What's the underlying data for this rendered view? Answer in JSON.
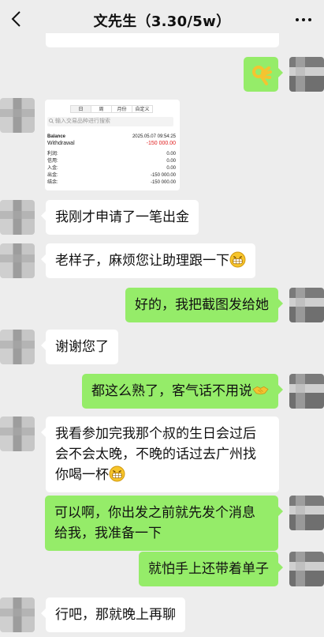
{
  "header": {
    "title": "文先生（3.30/5w）"
  },
  "screenshot": {
    "tabs": [
      "日",
      "周",
      "月份",
      "自定义"
    ],
    "search_placeholder": "输入交易品种进行搜索",
    "balance_label": "Balance",
    "balance_date": "2025.05.07 09:54:25",
    "withdrawal_label": "Withdrawal",
    "withdrawal_value": "-150 000.00",
    "rows": [
      {
        "label": "利润:",
        "value": "0.00"
      },
      {
        "label": "信用:",
        "value": "0.00"
      },
      {
        "label": "入金:",
        "value": "0.00"
      },
      {
        "label": "出金:",
        "value": "-150 000.00"
      },
      {
        "label": "结余:",
        "value": "-150 000.00"
      }
    ]
  },
  "messages": [
    {
      "side": "in",
      "text": "我刚才申请了一笔出金"
    },
    {
      "side": "in",
      "text": "老样子，麻烦您让助理跟一下"
    },
    {
      "side": "out",
      "text": "好的，我把截图发给她"
    },
    {
      "side": "in",
      "text": "谢谢您了"
    },
    {
      "side": "out",
      "text": "都这么熟了，客气话不用说"
    },
    {
      "side": "in",
      "line1": "我看参加完我那个叔的生日会过后",
      "line2": "会不会太晚，不晚的话过去广州找",
      "line3": "你喝一杯"
    },
    {
      "side": "out",
      "line1": "可以啊，你出发之前就先发个消息",
      "line2": "给我，我准备一下"
    },
    {
      "side": "out",
      "text": "就怕手上还带着单子"
    },
    {
      "side": "in",
      "text": "行吧，那就晚上再聊"
    }
  ],
  "icons": {
    "ok_hand": "ok-hand-emoji",
    "grin": "grin-emoji",
    "handshake": "handshake-emoji"
  },
  "colors": {
    "outgoing": "#95ec69",
    "incoming": "#ffffff",
    "background": "#ededed"
  }
}
